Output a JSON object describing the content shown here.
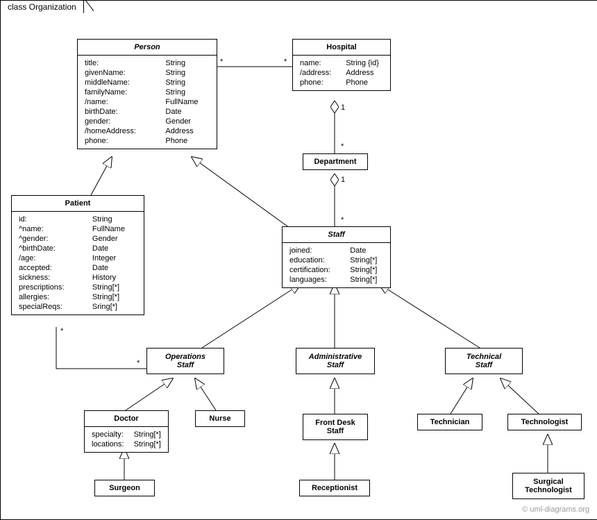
{
  "package": {
    "label": "class Organization"
  },
  "watermark": "© uml-diagrams.org",
  "classes": {
    "person": {
      "title": "Person",
      "attrs": [
        [
          "title:",
          "String"
        ],
        [
          "givenName:",
          "String"
        ],
        [
          "middleName:",
          "String"
        ],
        [
          "familyName:",
          "String"
        ],
        [
          "/name:",
          "FullName"
        ],
        [
          "birthDate:",
          "Date"
        ],
        [
          "gender:",
          "Gender"
        ],
        [
          "/homeAddress:",
          "Address"
        ],
        [
          "phone:",
          "Phone"
        ]
      ]
    },
    "hospital": {
      "title": "Hospital",
      "attrs": [
        [
          "name:",
          "String {id}"
        ],
        [
          "/address:",
          "Address"
        ],
        [
          "phone:",
          "Phone"
        ]
      ]
    },
    "department": {
      "title": "Department"
    },
    "patient": {
      "title": "Patient",
      "attrs": [
        [
          "id:",
          "String"
        ],
        [
          "^name:",
          "FullName"
        ],
        [
          "^gender:",
          "Gender"
        ],
        [
          "^birthDate:",
          "Date"
        ],
        [
          "/age:",
          "Integer"
        ],
        [
          "accepted:",
          "Date"
        ],
        [
          "sickness:",
          "History"
        ],
        [
          "prescriptions:",
          "String[*]"
        ],
        [
          "allergies:",
          "String[*]"
        ],
        [
          "specialReqs:",
          "Sring[*]"
        ]
      ]
    },
    "staff": {
      "title": "Staff",
      "attrs": [
        [
          "joined:",
          "Date"
        ],
        [
          "education:",
          "String[*]"
        ],
        [
          "certification:",
          "String[*]"
        ],
        [
          "languages:",
          "String[*]"
        ]
      ]
    },
    "operationsStaff": {
      "title": "Operations\nStaff"
    },
    "administrativeStaff": {
      "title": "Administrative\nStaff"
    },
    "technicalStaff": {
      "title": "Technical\nStaff"
    },
    "doctor": {
      "title": "Doctor",
      "attrs": [
        [
          "specialty:",
          "String[*]"
        ],
        [
          "locations:",
          "String[*]"
        ]
      ]
    },
    "nurse": {
      "title": "Nurse"
    },
    "frontDeskStaff": {
      "title": "Front Desk\nStaff"
    },
    "receptionist": {
      "title": "Receptionist"
    },
    "technician": {
      "title": "Technician"
    },
    "technologist": {
      "title": "Technologist"
    },
    "surgeon": {
      "title": "Surgeon"
    },
    "surgicalTechnologist": {
      "title": "Surgical\nTechnologist"
    }
  },
  "multiplicities": {
    "m1": "*",
    "m2": "*",
    "m3": "1",
    "m4": "*",
    "m5": "1",
    "m6": "*",
    "m7": "*",
    "m8": "*"
  }
}
